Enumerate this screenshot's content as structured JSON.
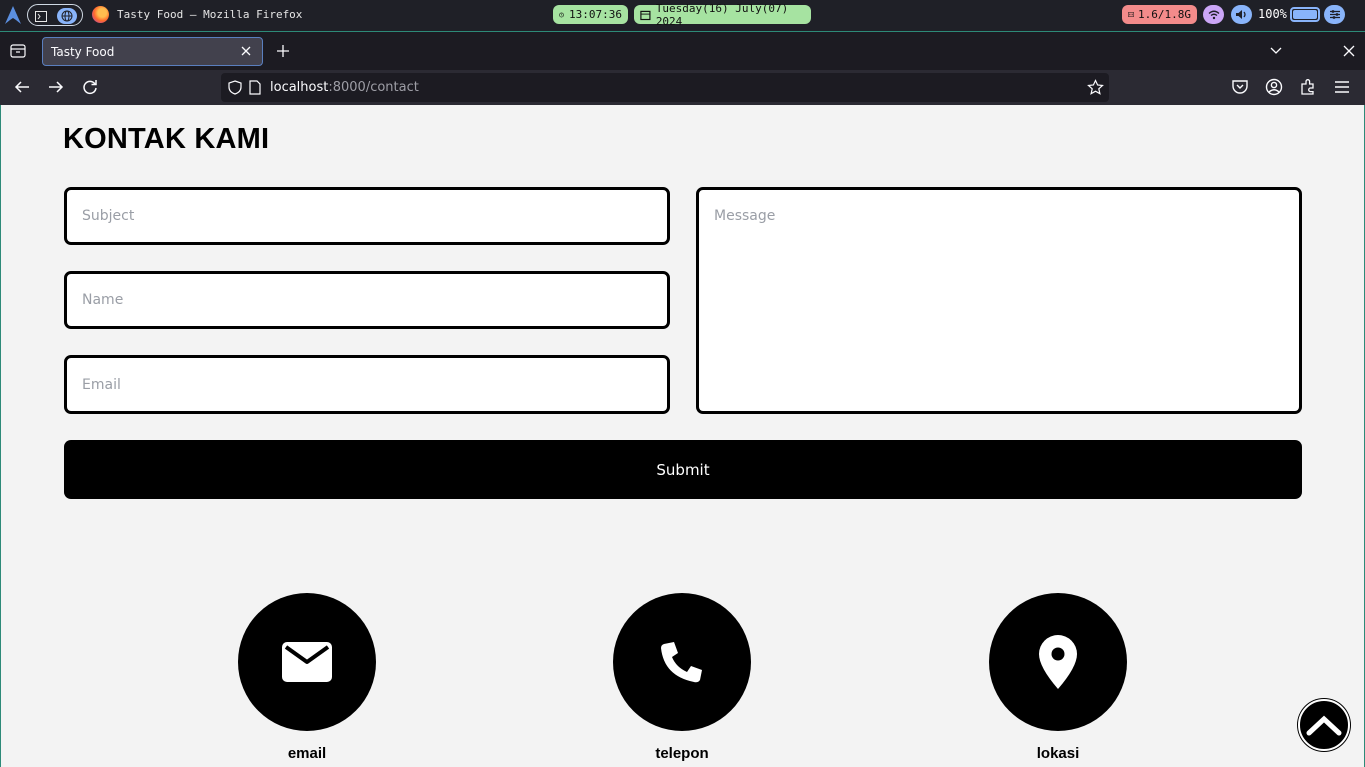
{
  "system_bar": {
    "window_title": "Tasty Food — Mozilla Firefox",
    "clock": "13:07:36",
    "date": "Tuesday(16) July(07) 2024",
    "memory": "1.6/1.8G",
    "volume": "100%"
  },
  "browser": {
    "tab_title": "Tasty Food",
    "url_host": "localhost",
    "url_path": ":8000/contact"
  },
  "page": {
    "title": "KONTAK KAMI",
    "form": {
      "subject_placeholder": "Subject",
      "name_placeholder": "Name",
      "email_placeholder": "Email",
      "message_placeholder": "Message",
      "submit_label": "Submit"
    },
    "contacts": [
      {
        "label": "email",
        "icon": "envelope-icon"
      },
      {
        "label": "telepon",
        "icon": "phone-icon"
      },
      {
        "label": "lokasi",
        "icon": "location-pin-icon"
      }
    ]
  },
  "colors": {
    "accent_green": "#a6e3a1",
    "accent_blue": "#89b4fa",
    "memory_red": "#f38b8b",
    "page_bg": "#f3f3f3",
    "button_bg": "#000000"
  }
}
